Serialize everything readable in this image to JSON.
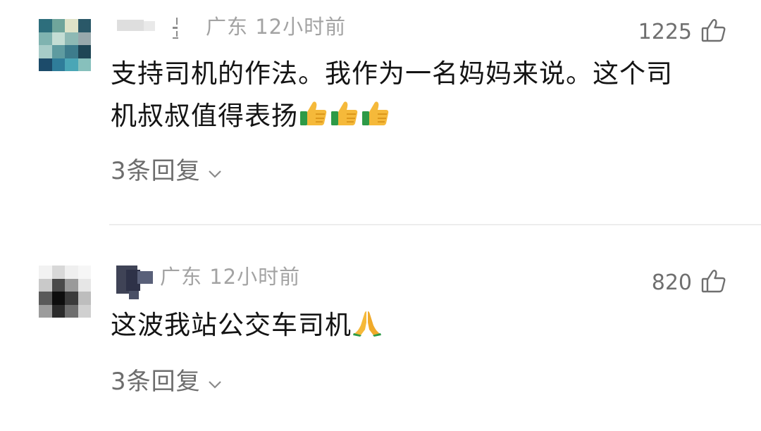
{
  "comments": [
    {
      "location": "广东",
      "time": "12小时前",
      "likes": "1225",
      "text_line1": "支持司机的作法。我作为一名妈妈来说。这个司",
      "text_line2": "机叔叔值得表扬",
      "emoji": [
        "thumbs-up",
        "thumbs-up",
        "thumbs-up"
      ],
      "replies": "3条回复"
    },
    {
      "location": "广东",
      "time": "12小时前",
      "likes": "820",
      "text_line1": "这波我站公交车司机",
      "emoji": [
        "folded-hands"
      ],
      "replies": "3条回复"
    }
  ],
  "colors": {
    "meta": "#a3a3a3",
    "text": "#141414",
    "secondary": "#6d6d6d",
    "divider": "#ededed"
  }
}
